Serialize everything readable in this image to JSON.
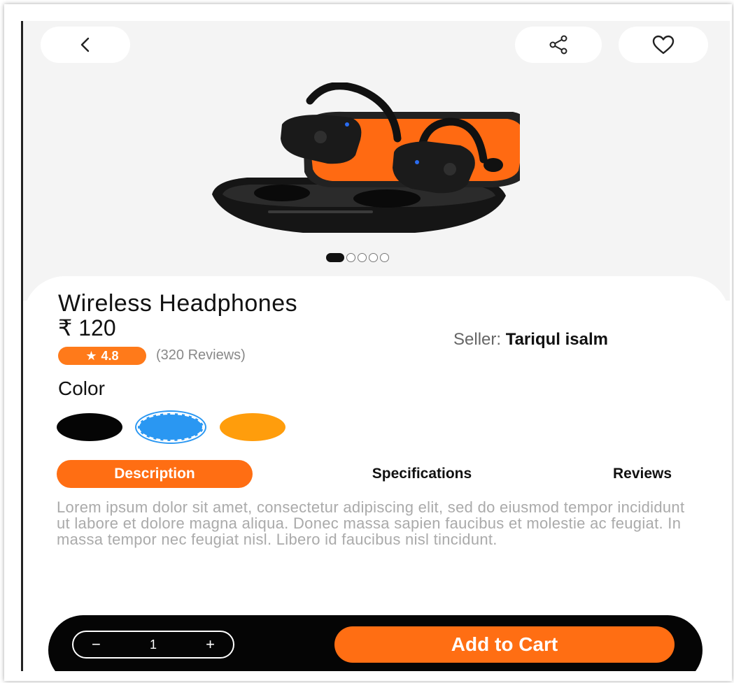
{
  "header": {
    "back_icon": "chevron-left-icon",
    "share_icon": "share-icon",
    "favorite_icon": "heart-icon"
  },
  "carousel": {
    "image_alt": "wireless-earbuds-with-orange-case",
    "total_slides": 5,
    "active_slide": 1
  },
  "product": {
    "title": "Wireless Headphones",
    "price": "₹ 120",
    "seller_label": "Seller:",
    "seller_name": "Tariqul isalm",
    "rating": "4.8",
    "reviews_count": "(320 Reviews)"
  },
  "color": {
    "label": "Color",
    "options": [
      {
        "name": "black",
        "hex": "#050505"
      },
      {
        "name": "blue",
        "hex": "#2a97f2",
        "selected": true
      },
      {
        "name": "orange",
        "hex": "#ff9d0c"
      }
    ]
  },
  "tabs": [
    {
      "label": "Description",
      "active": true
    },
    {
      "label": "Specifications",
      "active": false
    },
    {
      "label": "Reviews",
      "active": false
    }
  ],
  "description": "Lorem ipsum dolor sit amet, consectetur adipiscing elit, sed do eiusmod tempor incididunt ut labore et dolore magna aliqua. Donec massa sapien faucibus et molestie ac feugiat. In massa tempor nec feugiat nisl. Libero id faucibus nisl tincidunt.",
  "cart": {
    "minus": "−",
    "quantity": "1",
    "plus": "+",
    "add_label": "Add to Cart"
  },
  "colors": {
    "accent": "#ff6e13",
    "bar": "#050505"
  }
}
